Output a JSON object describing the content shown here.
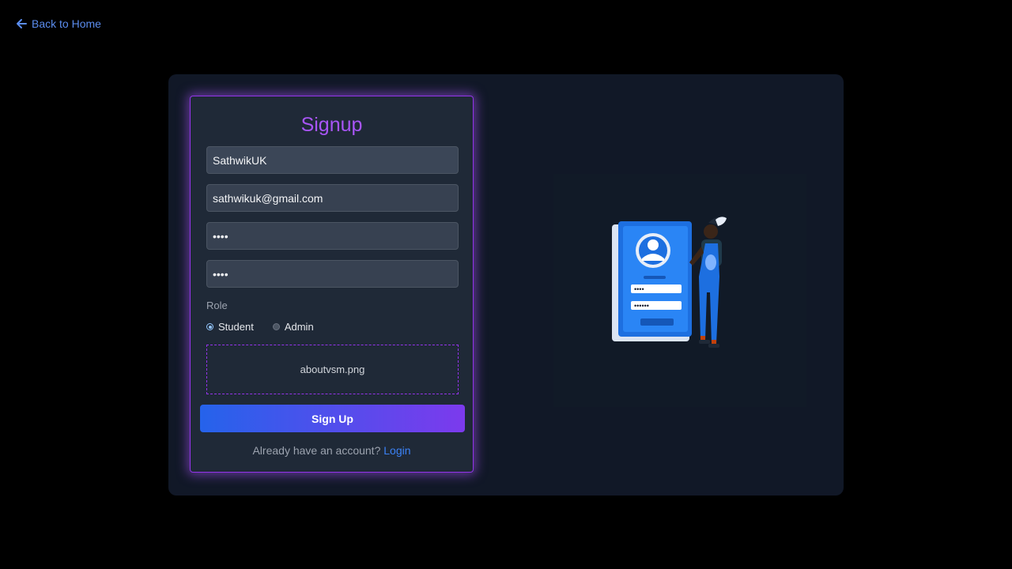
{
  "nav": {
    "back_label": "Back to Home"
  },
  "form": {
    "title": "Signup",
    "username_value": "SathwikUK",
    "email_value": "sathwikuk@gmail.com",
    "password_value": "1234",
    "confirm_password_value": "1234",
    "role_label": "Role",
    "roles": [
      {
        "label": "Student",
        "selected": true
      },
      {
        "label": "Admin",
        "selected": false
      }
    ],
    "file_name": "aboutvsm.png",
    "submit_label": "Sign Up",
    "login_prompt": "Already have an account?",
    "login_link": "Login"
  },
  "colors": {
    "accent_purple": "#a855f7",
    "link_blue": "#3b82f6",
    "button_gradient_start": "#2563eb",
    "button_gradient_end": "#7c3aed"
  },
  "illustration": {
    "icon": "signup-illustration",
    "password_masks": [
      "••••",
      "••••••"
    ]
  }
}
